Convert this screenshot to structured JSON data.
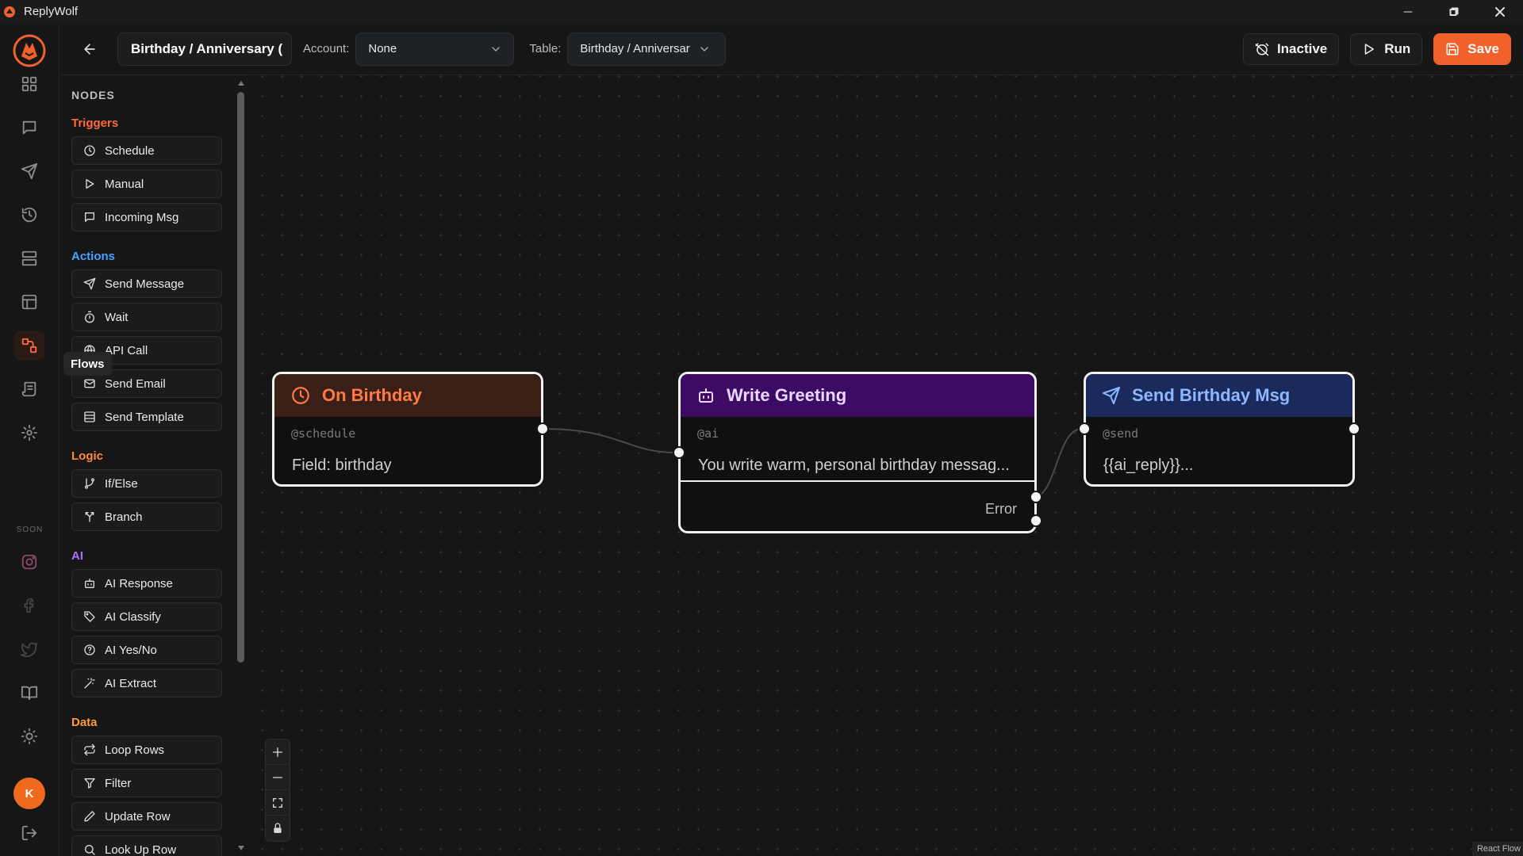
{
  "window": {
    "title": "ReplyWolf"
  },
  "rail": {
    "soon_label": "SOON",
    "avatar_letter": "K",
    "tooltip": "Flows",
    "accent": "#ff6a3d"
  },
  "toolbar": {
    "flow_name": "Birthday / Anniversary (",
    "account_label": "Account:",
    "account_value": "None",
    "table_label": "Table:",
    "table_value": "Birthday / Anniversar",
    "inactive_label": "Inactive",
    "run_label": "Run",
    "save_label": "Save"
  },
  "palette": {
    "title": "NODES",
    "sections": [
      {
        "name": "Triggers",
        "color": "#ff6a3d",
        "items": [
          "Schedule",
          "Manual",
          "Incoming Msg"
        ]
      },
      {
        "name": "Actions",
        "color": "#4ea1ff",
        "items": [
          "Send Message",
          "Wait",
          "API Call",
          "Send Email",
          "Send Template"
        ]
      },
      {
        "name": "Logic",
        "color": "#ff8a3d",
        "items": [
          "If/Else",
          "Branch"
        ]
      },
      {
        "name": "AI",
        "color": "#b06cff",
        "items": [
          "AI Response",
          "AI Classify",
          "AI Yes/No",
          "AI Extract"
        ]
      },
      {
        "name": "Data",
        "color": "#ff9a3d",
        "items": [
          "Loop Rows",
          "Filter",
          "Update Row",
          "Look Up Row"
        ]
      }
    ]
  },
  "nodes": {
    "trigger": {
      "title": "On Birthday",
      "handle": "@schedule",
      "body": "Field: birthday",
      "head_color": "#3a1f17",
      "title_color": "#ff7a45"
    },
    "ai": {
      "title": "Write Greeting",
      "handle": "@ai",
      "body": "You write warm, personal birthday messag...",
      "error_label": "Error",
      "head_color": "#3d0a66",
      "title_color": "#e9d8ff"
    },
    "send": {
      "title": "Send Birthday Msg",
      "handle": "@send",
      "body": "{{ai_reply}}...",
      "head_color": "#1b2a5c",
      "title_color": "#8fb7ff"
    }
  },
  "canvas": {
    "attribution": "React Flow"
  }
}
